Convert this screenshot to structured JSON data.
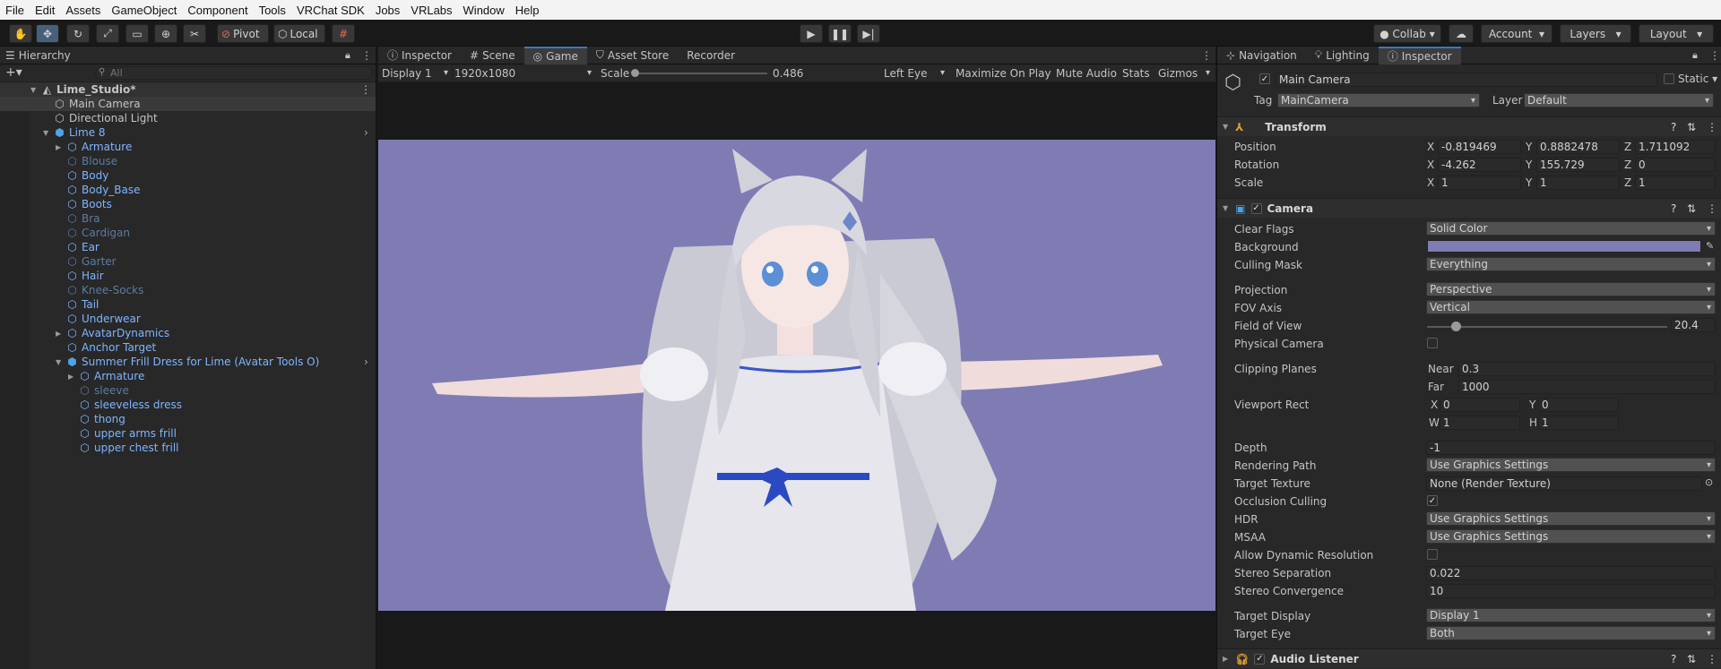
{
  "menu": [
    "File",
    "Edit",
    "Assets",
    "GameObject",
    "Component",
    "Tools",
    "VRChat SDK",
    "Jobs",
    "VRLabs",
    "Window",
    "Help"
  ],
  "toolbar": {
    "pivot": "Pivot",
    "local": "Local",
    "collab": "Collab",
    "account": "Account",
    "layers": "Layers",
    "layout": "Layout"
  },
  "hierarchy": {
    "tab": "Hierarchy",
    "search_placeholder": "All",
    "scene": "Lime_Studio*",
    "rows": [
      {
        "label": "Main Camera"
      },
      {
        "label": "Directional Light"
      },
      {
        "label": "Lime 8"
      },
      {
        "label": "Armature"
      },
      {
        "label": "Blouse"
      },
      {
        "label": "Body"
      },
      {
        "label": "Body_Base"
      },
      {
        "label": "Boots"
      },
      {
        "label": "Bra"
      },
      {
        "label": "Cardigan"
      },
      {
        "label": "Ear"
      },
      {
        "label": "Garter"
      },
      {
        "label": "Hair"
      },
      {
        "label": "Knee-Socks"
      },
      {
        "label": "Tail"
      },
      {
        "label": "Underwear"
      },
      {
        "label": "AvatarDynamics"
      },
      {
        "label": "Anchor Target"
      },
      {
        "label": "Summer Frill Dress for Lime (Avatar Tools O)"
      },
      {
        "label": "Armature"
      },
      {
        "label": "sleeve"
      },
      {
        "label": "sleeveless dress"
      },
      {
        "label": "thong"
      },
      {
        "label": "upper arms frill"
      },
      {
        "label": "upper chest frill"
      }
    ]
  },
  "center_tabs": [
    "Inspector",
    "Scene",
    "Game",
    "Asset Store",
    "Recorder"
  ],
  "game_bar": {
    "display": "Display 1",
    "resolution": "1920x1080",
    "scale_label": "Scale",
    "scale_value": "0.486",
    "scale_level": 0.0,
    "eye": "Left Eye",
    "maximize": "Maximize On Play",
    "mute": "Mute Audio",
    "stats": "Stats",
    "gizmos": "Gizmos"
  },
  "right_tabs": [
    "Navigation",
    "Lighting",
    "Inspector"
  ],
  "inspector": {
    "object_name": "Main Camera",
    "static": "Static",
    "tag_label": "Tag",
    "tag": "MainCamera",
    "layer_label": "Layer",
    "layer": "Default",
    "transform": {
      "title": "Transform",
      "position_label": "Position",
      "position": {
        "x": "-0.819469",
        "y": "0.8882478",
        "z": "1.711092"
      },
      "rotation_label": "Rotation",
      "rotation": {
        "x": "-4.262",
        "y": "155.729",
        "z": "0"
      },
      "scale_label": "Scale",
      "scale": {
        "x": "1",
        "y": "1",
        "z": "1"
      }
    },
    "camera": {
      "title": "Camera",
      "clear_flags_label": "Clear Flags",
      "clear_flags": "Solid Color",
      "background_label": "Background",
      "background_color": "#7f7cb4",
      "culling_mask_label": "Culling Mask",
      "culling_mask": "Everything",
      "projection_label": "Projection",
      "projection": "Perspective",
      "fov_axis_label": "FOV Axis",
      "fov_axis": "Vertical",
      "fov_label": "Field of View",
      "fov": "20.4",
      "fov_level": 0.12,
      "physical_label": "Physical Camera",
      "clipping_label": "Clipping Planes",
      "near_label": "Near",
      "near": "0.3",
      "far_label": "Far",
      "far": "1000",
      "viewport_label": "Viewport Rect",
      "vx": "0",
      "vy": "0",
      "vw": "1",
      "vh": "1",
      "depth_label": "Depth",
      "depth": "-1",
      "rendering_path_label": "Rendering Path",
      "rendering_path": "Use Graphics Settings",
      "target_texture_label": "Target Texture",
      "target_texture": "None (Render Texture)",
      "occlusion_label": "Occlusion Culling",
      "hdr_label": "HDR",
      "hdr": "Use Graphics Settings",
      "msaa_label": "MSAA",
      "msaa": "Use Graphics Settings",
      "dynres_label": "Allow Dynamic Resolution",
      "stereo_sep_label": "Stereo Separation",
      "stereo_sep": "0.022",
      "stereo_conv_label": "Stereo Convergence",
      "stereo_conv": "10",
      "target_display_label": "Target Display",
      "target_display": "Display 1",
      "target_eye_label": "Target Eye",
      "target_eye": "Both"
    },
    "audio_listener": {
      "title": "Audio Listener"
    }
  }
}
